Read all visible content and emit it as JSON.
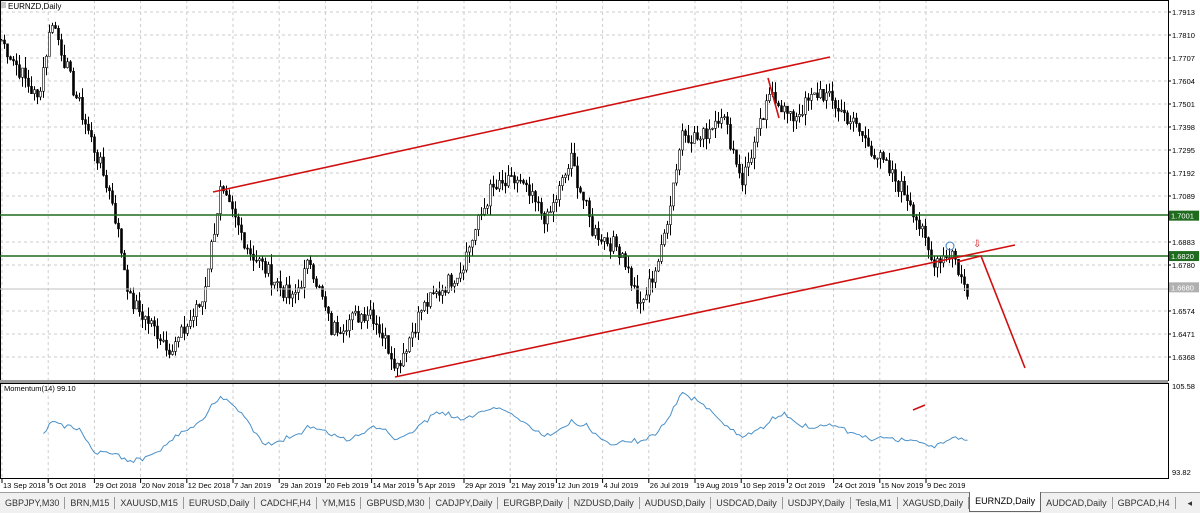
{
  "window": {
    "title": "EURNZD,Daily"
  },
  "price_axis": {
    "labels": [
      "1.7913",
      "1.7810",
      "1.7707",
      "1.7604",
      "1.7501",
      "1.7398",
      "1.7295",
      "1.7192",
      "1.7089",
      "1.6883",
      "1.6780",
      "1.6574",
      "1.6471",
      "1.6368"
    ],
    "marker_levels": [
      {
        "label": "1.7001",
        "color": "#1e6b1e"
      },
      {
        "label": "1.6820",
        "color": "#1e6b1e"
      },
      {
        "label": "1.6680",
        "color": "#b0b0b0"
      }
    ]
  },
  "indicator": {
    "label": "Momentum(14) 99.10",
    "max": "105.58",
    "min": "93.82",
    "color": "#4a90c8"
  },
  "time_axis": [
    "13 Sep 2018",
    "5 Oct 2018",
    "29 Oct 2018",
    "20 Nov 2018",
    "12 Dec 2018",
    "7 Jan 2019",
    "29 Jan 2019",
    "20 Feb 2019",
    "14 Mar 2019",
    "5 Apr 2019",
    "29 Apr 2019",
    "21 May 2019",
    "12 Jun 2019",
    "4 Jul 2019",
    "26 Jul 2019",
    "19 Aug 2019",
    "10 Sep 2019",
    "2 Oct 2019",
    "24 Oct 2019",
    "15 Nov 2019",
    "9 Dec 2019"
  ],
  "chart_data": {
    "type": "candlestick",
    "symbol": "EURNZD",
    "timeframe": "Daily",
    "ylim": [
      1.63,
      1.795
    ],
    "path": [
      [
        0,
        1.7788
      ],
      [
        12,
        1.752
      ],
      [
        17,
        1.788
      ],
      [
        23,
        1.761
      ],
      [
        37,
        1.707
      ],
      [
        43,
        1.662
      ],
      [
        57,
        1.64
      ],
      [
        67,
        1.662
      ],
      [
        73,
        1.711
      ],
      [
        83,
        1.684
      ],
      [
        97,
        1.662
      ],
      [
        103,
        1.68
      ],
      [
        110,
        1.649
      ],
      [
        123,
        1.658
      ],
      [
        132,
        1.633
      ],
      [
        140,
        1.658
      ],
      [
        153,
        1.676
      ],
      [
        163,
        1.711
      ],
      [
        172,
        1.716
      ],
      [
        182,
        1.698
      ],
      [
        190,
        1.725
      ],
      [
        197,
        1.694
      ],
      [
        207,
        1.684
      ],
      [
        213,
        1.658
      ],
      [
        220,
        1.684
      ],
      [
        227,
        1.738
      ],
      [
        233,
        1.734
      ],
      [
        240,
        1.747
      ],
      [
        247,
        1.716
      ],
      [
        257,
        1.756
      ],
      [
        263,
        1.743
      ],
      [
        273,
        1.756
      ],
      [
        283,
        1.743
      ],
      [
        293,
        1.725
      ],
      [
        303,
        1.707
      ],
      [
        310,
        1.68
      ],
      [
        317,
        1.684
      ],
      [
        322,
        1.664
      ]
    ]
  },
  "tabs": [
    "GBPJPY,M30",
    "BRN,M15",
    "XAUUSD,M15",
    "EURUSD,Daily",
    "CADCHF,H4",
    "YM,M15",
    "GBPUSD,M30",
    "CADJPY,Daily",
    "EURGBP,Daily",
    "NZDUSD,Daily",
    "AUDUSD,Daily",
    "USDCAD,Daily",
    "USDJPY,Daily",
    "Tesla,M1",
    "XAGUSD,Daily",
    "EURNZD,Daily",
    "AUDCAD,Daily",
    "GBPCAD,H4"
  ],
  "active_tab": "EURNZD,Daily",
  "colors": {
    "trendline": "#d01010",
    "level": "#1e6b1e"
  }
}
